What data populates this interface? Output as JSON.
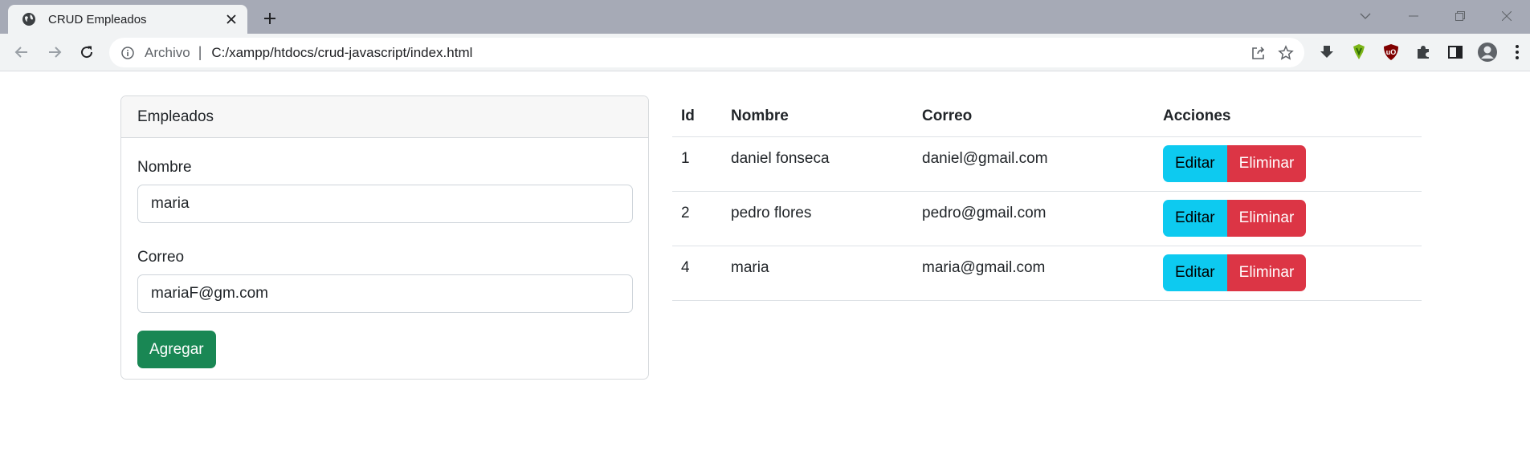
{
  "browser": {
    "tab_title": "CRUD Empleados",
    "scheme_label": "Archivo",
    "separator": "|",
    "url": "C:/xampp/htdocs/crud-javascript/index.html"
  },
  "form": {
    "header": "Empleados",
    "nombre_label": "Nombre",
    "nombre_value": "maria",
    "correo_label": "Correo",
    "correo_value": "mariaF@gm.com",
    "submit_label": "Agregar"
  },
  "table": {
    "headers": [
      "Id",
      "Nombre",
      "Correo",
      "Acciones"
    ],
    "rows": [
      {
        "id": "1",
        "nombre": "daniel fonseca",
        "correo": "daniel@gmail.com"
      },
      {
        "id": "2",
        "nombre": "pedro flores",
        "correo": "pedro@gmail.com"
      },
      {
        "id": "4",
        "nombre": "maria",
        "correo": "maria@gmail.com"
      }
    ],
    "edit_label": "Editar",
    "delete_label": "Eliminar"
  },
  "colors": {
    "success": "#198754",
    "info": "#0dcaf0",
    "danger": "#dc3545"
  },
  "icons": [
    "globe-icon",
    "close-icon",
    "plus-icon",
    "back-icon",
    "forward-icon",
    "reload-icon",
    "info-icon",
    "share-icon",
    "star-icon",
    "download-icon",
    "extension-icon",
    "ublock-icon",
    "puzzle-icon",
    "sidepanel-icon",
    "profile-icon",
    "menu-icon"
  ]
}
